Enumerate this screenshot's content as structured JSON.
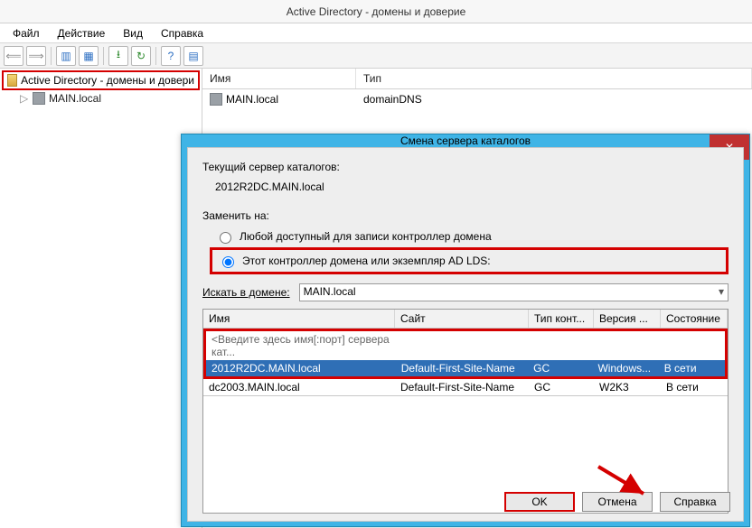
{
  "window": {
    "title": "Active Directory - домены и доверие"
  },
  "menu": {
    "file": "Файл",
    "action": "Действие",
    "view": "Вид",
    "help": "Справка"
  },
  "tree": {
    "root": "Active Directory - домены и довери",
    "child": "MAIN.local"
  },
  "list": {
    "col_name": "Имя",
    "col_type": "Тип",
    "row1_name": "MAIN.local",
    "row1_type": "domainDNS"
  },
  "dialog": {
    "title": "Смена сервера каталогов",
    "close": "✕",
    "current_label": "Текущий сервер каталогов:",
    "current_value": "2012R2DC.MAIN.local",
    "replace_label": "Заменить на:",
    "radio_any": "Любой доступный для записи контроллер домена",
    "radio_this": "Этот контроллер домена или экземпляр AD LDS:",
    "search_label": "Искать в домене:",
    "search_value": "MAIN.local",
    "grid": {
      "col_name": "Имя",
      "col_site": "Сайт",
      "col_type": "Тип конт...",
      "col_ver": "Версия ...",
      "col_state": "Состояние",
      "hint": "<Введите здесь имя[:порт] сервера кат...",
      "rows": [
        {
          "name": "2012R2DC.MAIN.local",
          "site": "Default-First-Site-Name",
          "type": "GC",
          "ver": "Windows...",
          "state": "В сети"
        },
        {
          "name": "dc2003.MAIN.local",
          "site": "Default-First-Site-Name",
          "type": "GC",
          "ver": "W2K3",
          "state": "В сети"
        }
      ]
    },
    "ok": "OK",
    "cancel": "Отмена",
    "help": "Справка"
  }
}
